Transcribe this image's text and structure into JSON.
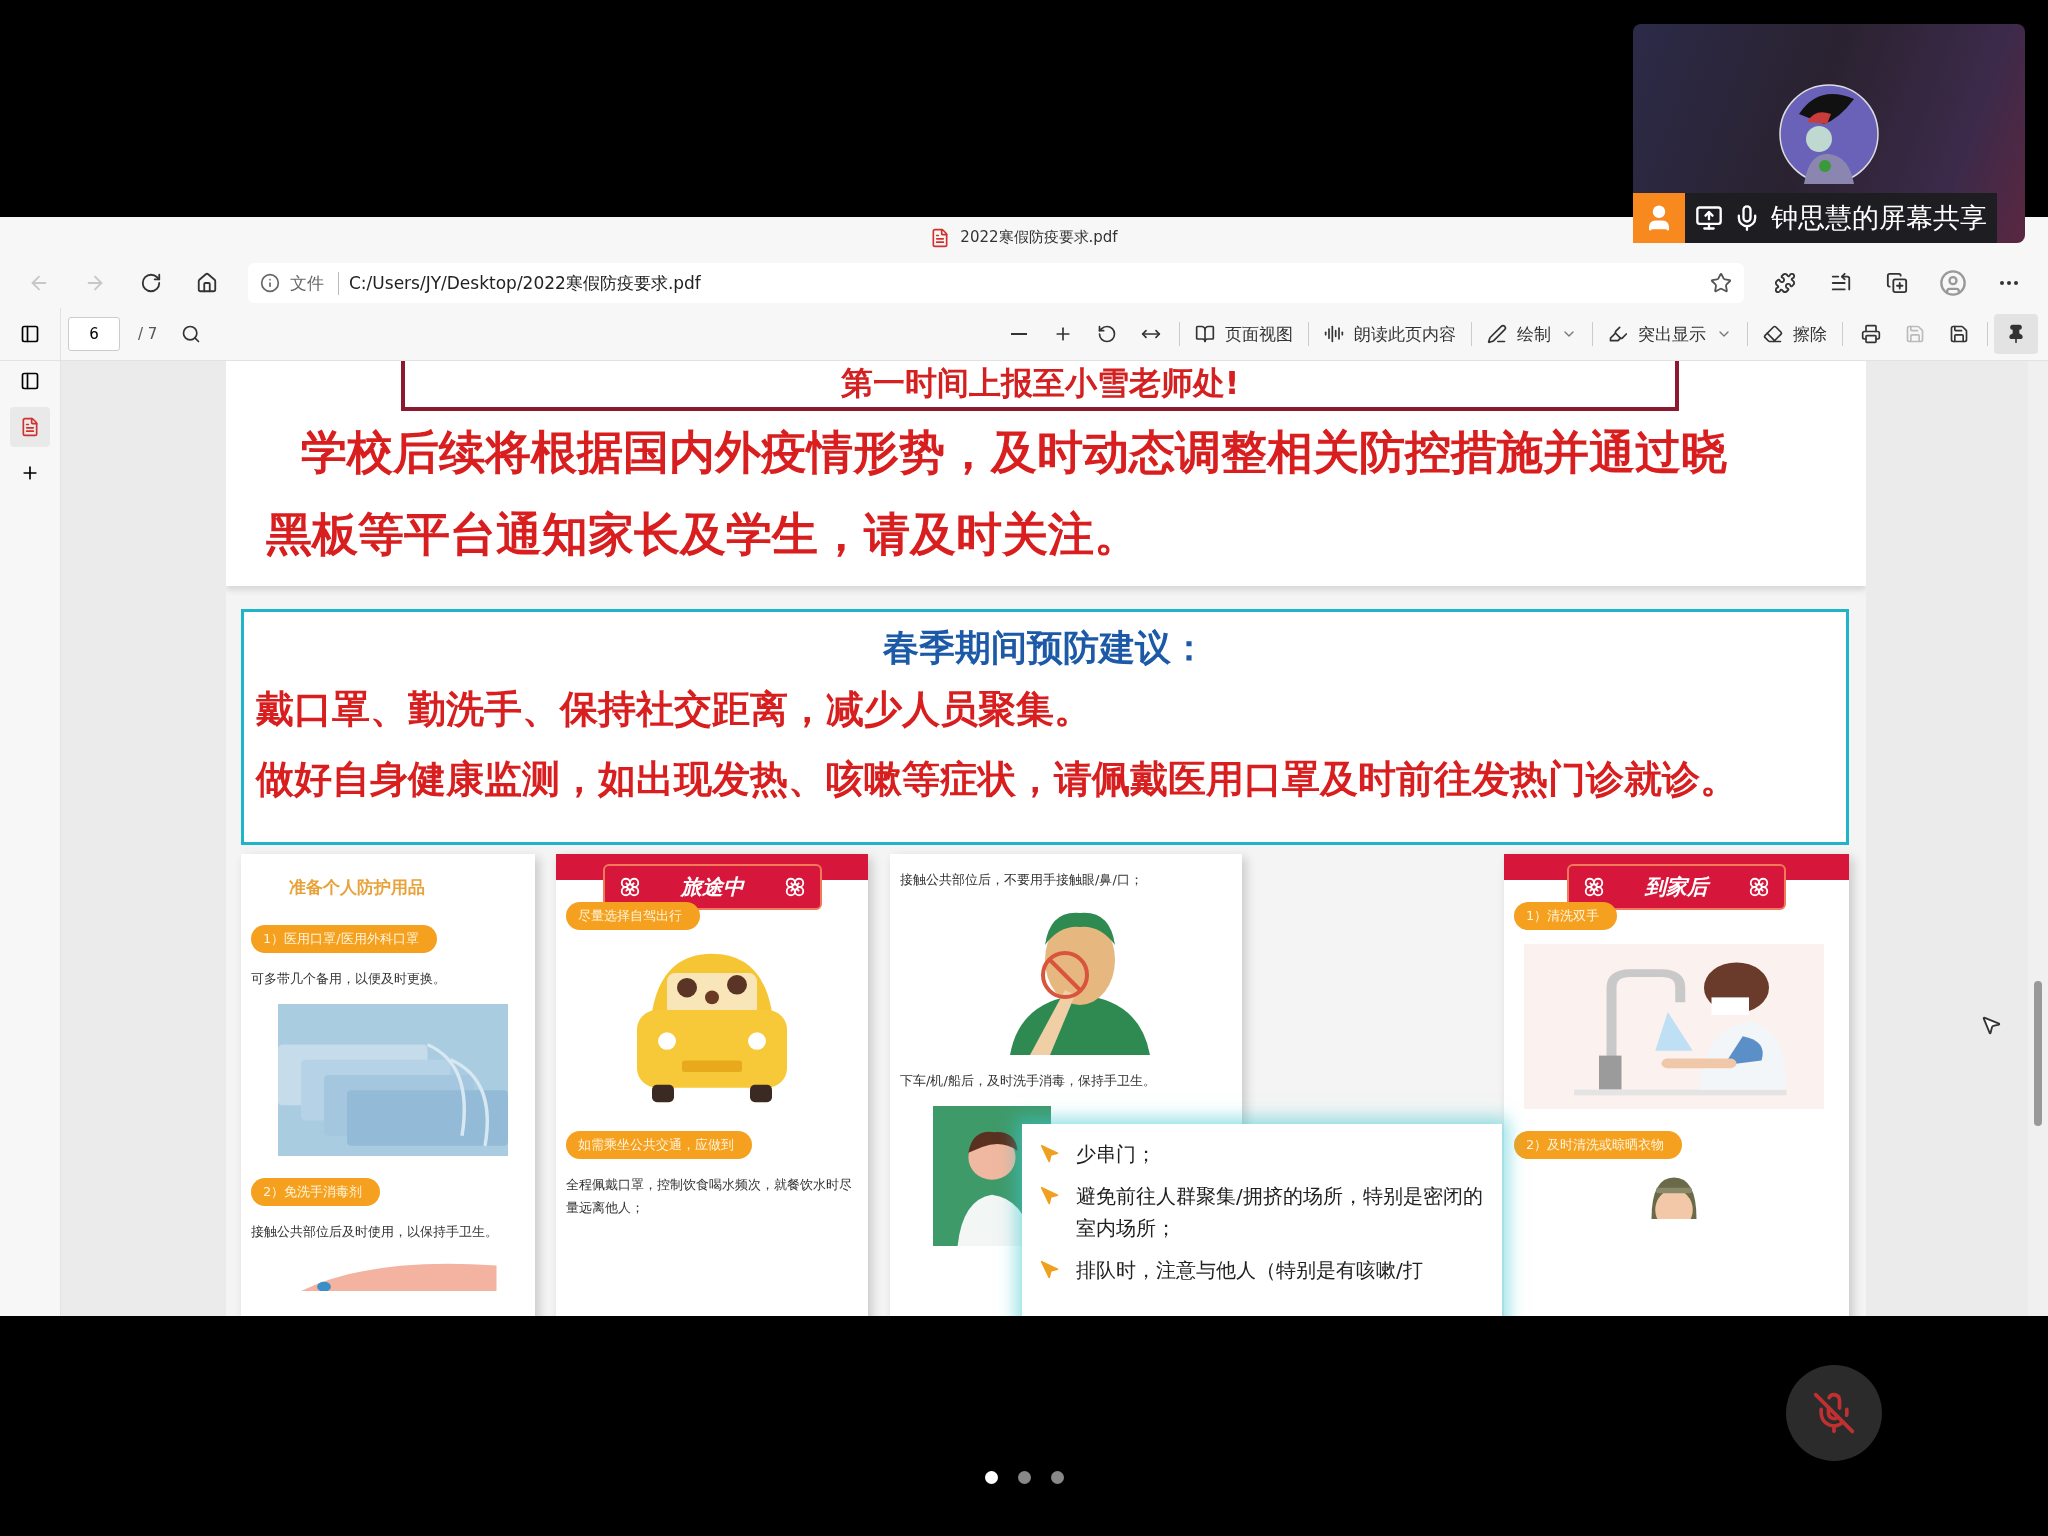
{
  "meeting_tile": {
    "presenter_label": "钟思慧的屏幕共享"
  },
  "browser": {
    "tab_title": "2022寒假防疫要求.pdf",
    "address_scheme": "文件",
    "address_url": "C:/Users/JY/Desktop/2022寒假防疫要求.pdf"
  },
  "pdf_toolbar": {
    "page_number": "6",
    "page_count": "/ 7",
    "pinned": true,
    "tools": [
      {
        "kind": "page_view",
        "label": "页面视图",
        "dropdown": false
      },
      {
        "kind": "read_aloud",
        "label": "朗读此页内容",
        "dropdown": false
      },
      {
        "kind": "draw",
        "label": "绘制",
        "dropdown": true
      },
      {
        "kind": "highlight",
        "label": "突出显示",
        "dropdown": true
      },
      {
        "kind": "erase",
        "label": "擦除",
        "dropdown": false
      }
    ]
  },
  "document": {
    "banner_heading": "第一时间上报至小雪老师处!",
    "notice_lines": [
      "学校后续将根据国内外疫情形势，及时动态调整相关防控措施并通过晓",
      "黑板等平台通知家长及学生，请及时关注。"
    ],
    "advice": {
      "title": "春季期间预防建议：",
      "lines": [
        "戴口罩、勤洗手、保持社交距离，减少人员聚集。",
        "做好自身健康监测，如出现发热、咳嗽等症状，请佩戴医用口罩及时前往发热门诊就诊。"
      ]
    },
    "cards": [
      {
        "kind": "plain",
        "title": "准备个人防护用品",
        "blocks": [
          {
            "kind": "pill",
            "text": "1）医用口罩/医用外科口罩"
          },
          {
            "kind": "text",
            "text": "可多带几个备用，以便及时更换。"
          },
          {
            "kind": "picture"
          },
          {
            "kind": "pill",
            "text": "2）免洗手消毒剂"
          },
          {
            "kind": "text",
            "text": "接触公共部位后及时使用，以保持手卫生。"
          },
          {
            "kind": "picture"
          }
        ]
      },
      {
        "kind": "banner",
        "title": "旅途中",
        "blocks": [
          {
            "kind": "pill",
            "text": "尽量选择自驾出行"
          },
          {
            "kind": "picture"
          },
          {
            "kind": "pill",
            "text": "如需乘坐公共交通，应做到"
          },
          {
            "kind": "text",
            "text": "全程佩戴口罩，控制饮食喝水频次，就餐饮水时尽量远离他人；"
          }
        ]
      },
      {
        "kind": "plain",
        "blocks": [
          {
            "kind": "text",
            "text": "接触公共部位后，不要用手接触眼/鼻/口；"
          },
          {
            "kind": "picture"
          },
          {
            "kind": "text",
            "text": "下车/机/船后，及时洗手消毒，保持手卫生。"
          },
          {
            "kind": "picture"
          }
        ]
      },
      {
        "kind": "banner",
        "title": "到家后",
        "blocks": [
          {
            "kind": "pill",
            "text": "1）清洗双手"
          },
          {
            "kind": "picture"
          },
          {
            "kind": "pill",
            "text": "2）及时清洗或晾晒衣物"
          },
          {
            "kind": "picture"
          }
        ]
      }
    ],
    "callout": {
      "items": [
        "少串门；",
        "避免前往人群聚集/拥挤的场所，特别是密闭的室内场所；",
        "排队时，注意与他人（特别是有咳嗽/打"
      ]
    }
  },
  "call_controls": {
    "mic_muted": true,
    "page_dots": [
      {
        "selected": true
      },
      {
        "selected": false
      },
      {
        "selected": false
      }
    ]
  }
}
